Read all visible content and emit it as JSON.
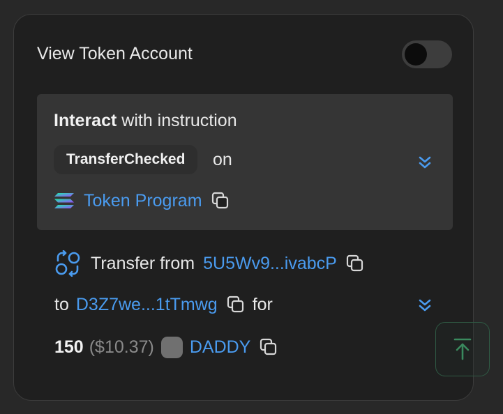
{
  "header": {
    "label": "View Token Account",
    "toggle_on": false
  },
  "instruction": {
    "title_bold": "Interact",
    "title_rest": " with instruction",
    "name": "TransferChecked",
    "on_label": "on",
    "program_name": "Token Program"
  },
  "transfer": {
    "label": "Transfer from",
    "from_address": "5U5Wv9...ivabcP",
    "to_label": "to",
    "to_address": "D3Z7we...1tTmwg",
    "for_label": "for",
    "amount": "150",
    "usd_value": "($10.37)",
    "token_symbol": "DADDY"
  },
  "colors": {
    "accent_link": "#4a9bef",
    "scroll_button": "#3a8a5e"
  },
  "icons": {
    "expand": "double-chevron-down-icon",
    "copy": "copy-icon",
    "transfer": "transfer-arrows-icon",
    "program": "solana-icon",
    "scroll_top": "arrow-up-to-line-icon"
  }
}
